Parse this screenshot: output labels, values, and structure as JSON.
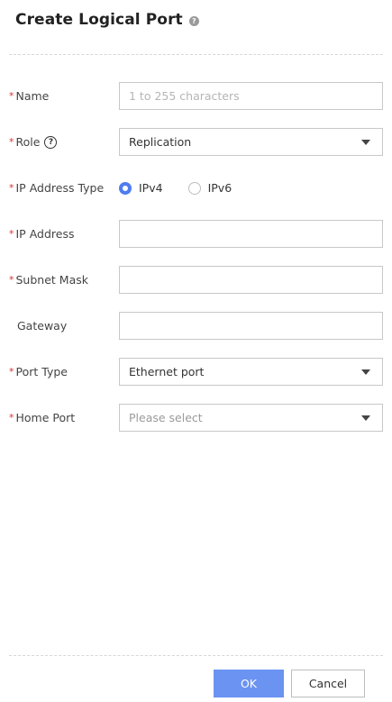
{
  "dialog": {
    "title": "Create Logical Port",
    "required_mark": "*"
  },
  "fields": {
    "name": {
      "label": "Name",
      "placeholder": "1 to 255 characters",
      "value": ""
    },
    "role": {
      "label": "Role",
      "value": "Replication",
      "help_glyph": "?"
    },
    "ip_address_type": {
      "label": "IP Address Type",
      "options": [
        "IPv4",
        "IPv6"
      ],
      "selected": "IPv4"
    },
    "ip_address": {
      "label": "IP Address",
      "value": ""
    },
    "subnet_mask": {
      "label": "Subnet Mask",
      "value": ""
    },
    "gateway": {
      "label": "Gateway",
      "value": ""
    },
    "port_type": {
      "label": "Port Type",
      "value": "Ethernet port"
    },
    "home_port": {
      "label": "Home Port",
      "placeholder": "Please select"
    }
  },
  "footer": {
    "ok_label": "OK",
    "cancel_label": "Cancel"
  },
  "colors": {
    "required": "#e0312b",
    "primary": "#6b93f1",
    "radio_checked": "#4f7df0"
  }
}
